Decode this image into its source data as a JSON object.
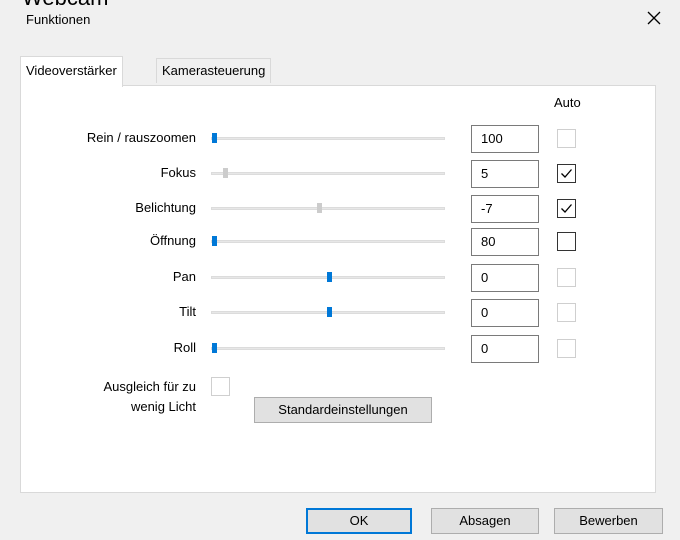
{
  "window": {
    "background_title": "Webcam",
    "title": "Funktionen",
    "close_icon": "close-icon"
  },
  "tabs": [
    {
      "label": "Videoverstärker",
      "active": true
    },
    {
      "label": "Kamerasteuerung",
      "active": false
    }
  ],
  "auto_header": "Auto",
  "rows": [
    {
      "label": "Rein / rauszoomen",
      "value": "100",
      "slider_fraction": 0.0,
      "slider_enabled": true,
      "auto_checked": false,
      "auto_enabled": false
    },
    {
      "label": "Fokus",
      "value": "5",
      "slider_fraction": 0.05,
      "slider_enabled": false,
      "auto_checked": true,
      "auto_enabled": true
    },
    {
      "label": "Belichtung",
      "value": "-7",
      "slider_fraction": 0.46,
      "slider_enabled": false,
      "auto_checked": true,
      "auto_enabled": true
    },
    {
      "label": "Öffnung",
      "value": "80",
      "slider_fraction": 0.0,
      "slider_enabled": true,
      "auto_checked": false,
      "auto_enabled": true
    },
    {
      "label": "Pan",
      "value": "0",
      "slider_fraction": 0.5,
      "slider_enabled": true,
      "auto_checked": false,
      "auto_enabled": false
    },
    {
      "label": "Tilt",
      "value": "0",
      "slider_fraction": 0.5,
      "slider_enabled": true,
      "auto_checked": false,
      "auto_enabled": false
    },
    {
      "label": "Roll",
      "value": "0",
      "slider_fraction": 0.0,
      "slider_enabled": true,
      "auto_checked": false,
      "auto_enabled": false
    }
  ],
  "low_light": {
    "label_line1": "Ausgleich für zu",
    "label_line2": "wenig Licht",
    "checked": false
  },
  "defaults_button": "Standardeinstellungen",
  "footer": {
    "ok": "OK",
    "cancel": "Absagen",
    "apply": "Bewerben"
  },
  "colors": {
    "accent": "#0078d7",
    "panel_bg": "#ffffff",
    "dialog_bg": "#f0f0f0"
  }
}
